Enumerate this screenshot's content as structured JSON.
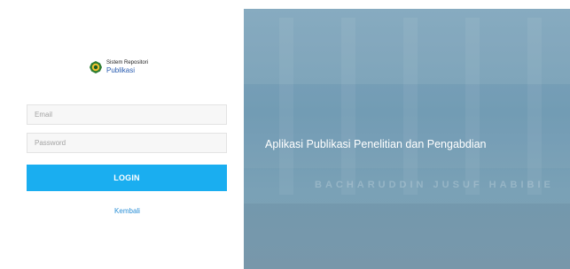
{
  "brand": {
    "line1": "Sistem Repositori",
    "line2": "Publikasi"
  },
  "form": {
    "email_placeholder": "Email",
    "password_placeholder": "Password",
    "login_label": "LOGIN",
    "back_label": "Kembali"
  },
  "hero": {
    "title": "Aplikasi Publikasi Penelitian dan Pengabdian",
    "sign_text": "BACHARUDDIN JUSUF HABIBIE"
  },
  "colors": {
    "accent": "#1aaef0",
    "brand_text": "#2a5db0",
    "hero_overlay": "#6d98b1"
  },
  "icons": {
    "logo": "university-seal-icon"
  }
}
